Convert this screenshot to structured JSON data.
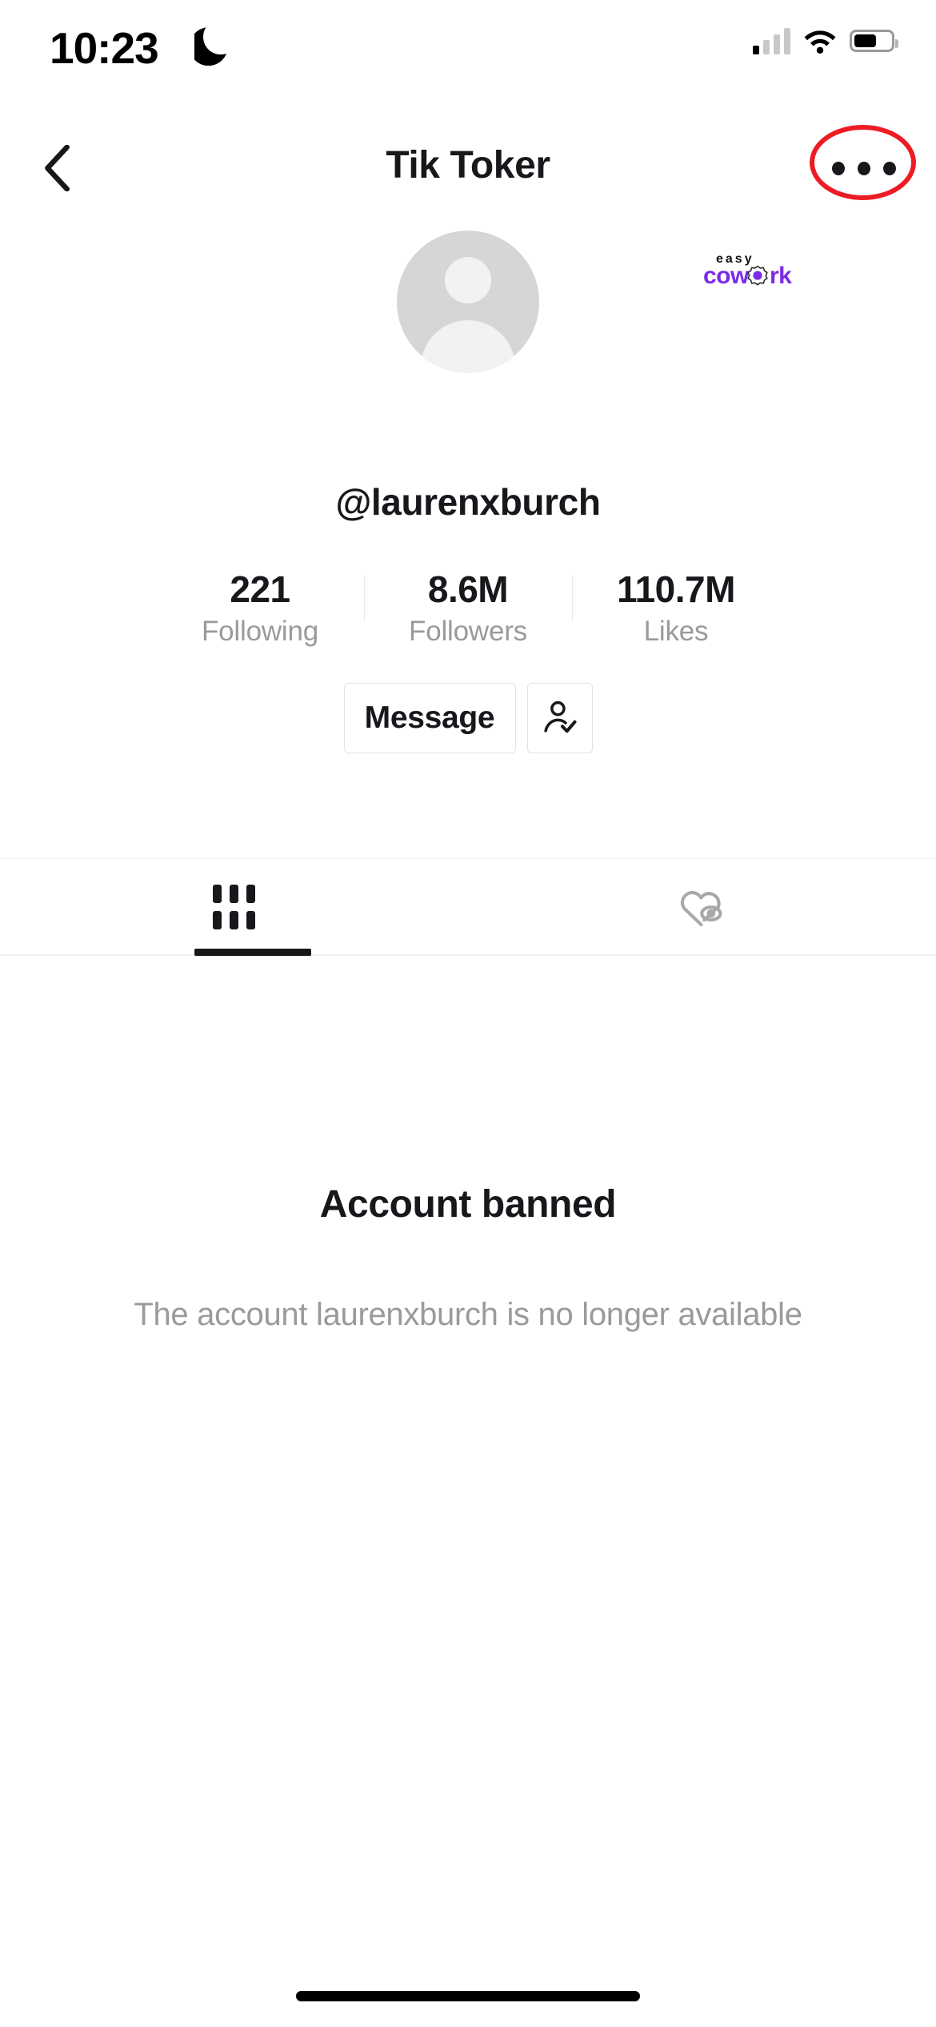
{
  "status_bar": {
    "time": "10:23",
    "dnd_icon": "crescent-moon-icon",
    "cellular_icon": "cellular-signal-icon",
    "wifi_icon": "wifi-icon",
    "battery_icon": "battery-icon",
    "battery_level_percent": 62
  },
  "nav": {
    "back_icon": "chevron-left-icon",
    "title": "Tik Toker",
    "more_icon": "more-horizontal-icon"
  },
  "annotation": {
    "type": "ellipse-highlight",
    "color": "#ed1c24",
    "target": "more-horizontal-icon"
  },
  "watermark": {
    "top_text": "easy",
    "brand_left": "cow",
    "brand_right": "rk",
    "gear_icon": "gear-icon",
    "color": "#7b2be8"
  },
  "profile": {
    "avatar_icon": "default-user-avatar",
    "handle": "@laurenxburch",
    "stats": [
      {
        "value": "221",
        "label": "Following"
      },
      {
        "value": "8.6M",
        "label": "Followers"
      },
      {
        "value": "110.7M",
        "label": "Likes"
      }
    ]
  },
  "actions": {
    "message_label": "Message",
    "follow_state_icon": "person-check-icon"
  },
  "tabs": [
    {
      "id": "videos",
      "icon": "grid-icon",
      "active": true
    },
    {
      "id": "liked",
      "icon": "heart-hidden-icon",
      "active": false
    }
  ],
  "empty_state": {
    "title": "Account banned",
    "subtitle": "The account laurenxburch is no longer available"
  },
  "home_indicator": "home-indicator"
}
